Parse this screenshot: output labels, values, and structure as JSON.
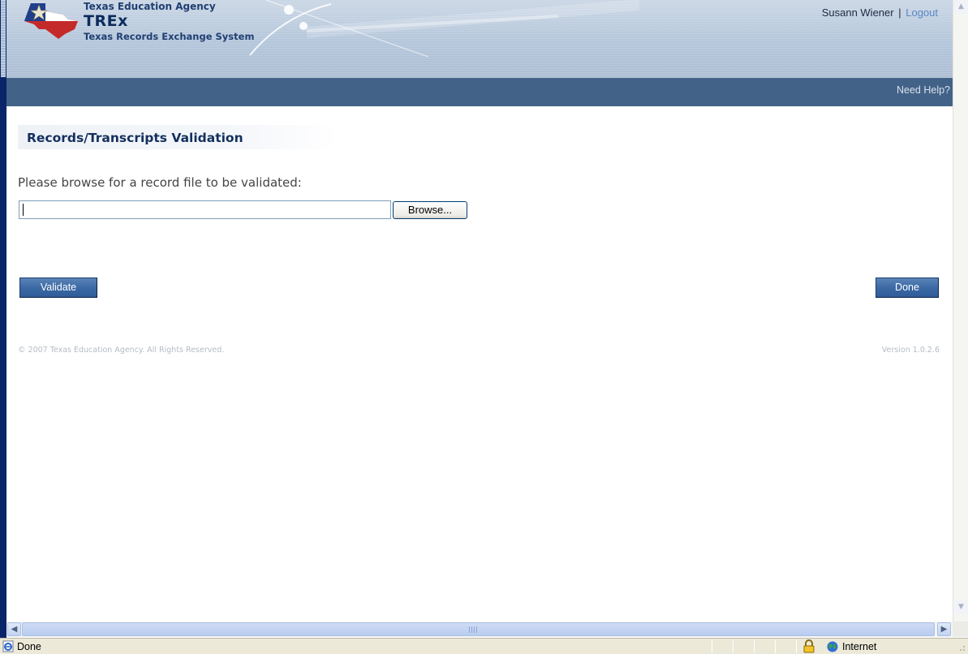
{
  "header": {
    "agency_name": "Texas Education Agency",
    "app_short_name": "TREx",
    "app_full_name": "Texas Records Exchange System",
    "user_name": "Susann Wiener",
    "separator": "|",
    "logout_label": "Logout"
  },
  "nav": {
    "help_label": "Need Help?"
  },
  "main": {
    "page_title": "Records/Transcripts Validation",
    "instruction": "Please browse for a record file to be validated:",
    "file_input_value": "",
    "browse_label": "Browse...",
    "validate_label": "Validate",
    "done_label": "Done"
  },
  "footer": {
    "copyright": "© 2007 Texas Education Agency. All Rights Reserved.",
    "version": "Version 1.0.2.6"
  },
  "statusbar": {
    "status_text": "Done",
    "zone_text": "Internet",
    "icons": [
      "ie-page-icon",
      "lock-icon",
      "globe-icon"
    ]
  },
  "colors": {
    "nav_bar": "#436287",
    "button_blue": "#3c6aa5",
    "title_text": "#14305e",
    "link": "#5a86c4"
  }
}
